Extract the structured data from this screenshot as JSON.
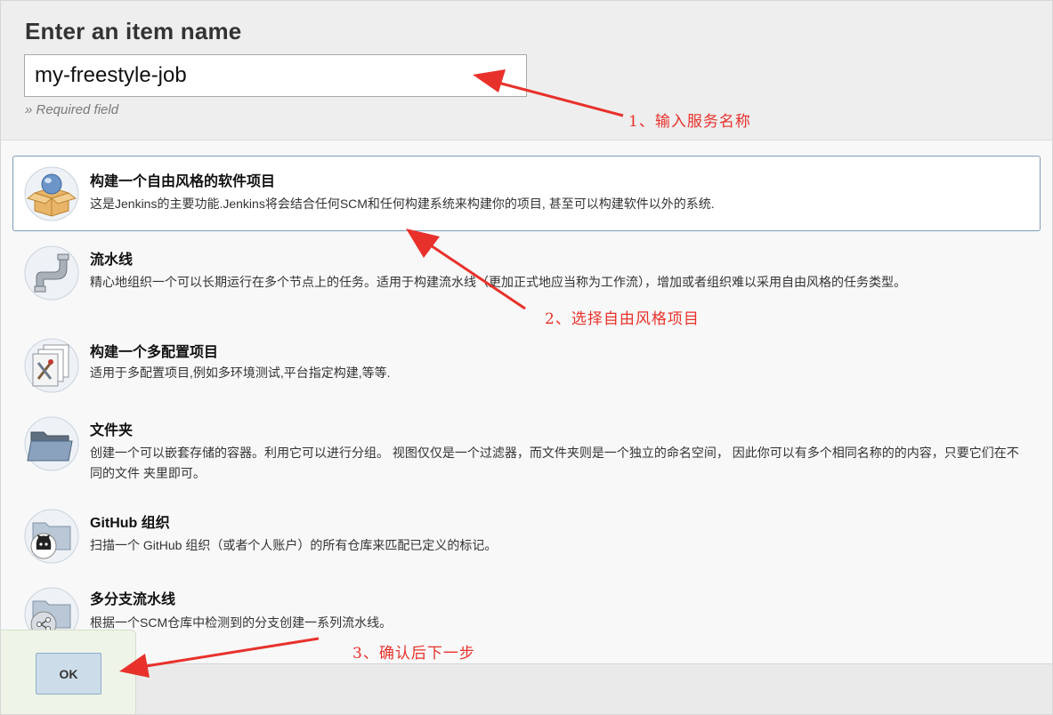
{
  "header": {
    "title": "Enter an item name",
    "item_name_value": "my-freestyle-job",
    "required_hint": "» Required field"
  },
  "items": [
    {
      "label": "构建一个自由风格的软件项目",
      "description": "这是Jenkins的主要功能.Jenkins将会结合任何SCM和任何构建系统来构建你的项目, 甚至可以构建软件以外的系统.",
      "icon": "freestyle-box-icon",
      "selected": true
    },
    {
      "label": "流水线",
      "description": "精心地组织一个可以长期运行在多个节点上的任务。适用于构建流水线（更加正式地应当称为工作流），增加或者组织难以采用自由风格的任务类型。",
      "icon": "pipeline-icon",
      "selected": false
    },
    {
      "label": "构建一个多配置项目",
      "description": "适用于多配置项目,例如多环境测试,平台指定构建,等等.",
      "icon": "multi-config-icon",
      "selected": false
    },
    {
      "label": "文件夹",
      "description": "创建一个可以嵌套存储的容器。利用它可以进行分组。 视图仅仅是一个过滤器，而文件夹则是一个独立的命名空间， 因此你可以有多个相同名称的的内容，只要它们在不同的文件 夹里即可。",
      "icon": "folder-icon",
      "selected": false
    },
    {
      "label": "GitHub 组织",
      "description": "扫描一个 GitHub 组织（或者个人账户）的所有仓库来匹配已定义的标记。",
      "icon": "github-organization-icon",
      "selected": false
    },
    {
      "label": "多分支流水线",
      "description": "根据一个SCM仓库中检测到的分支创建一系列流水线。",
      "icon": "multibranch-pipeline-icon",
      "selected": false
    }
  ],
  "footer": {
    "ok_label": "OK"
  },
  "annotations": {
    "step1": "1、输入服务名称",
    "step2": "2、选择自由风格项目",
    "step3": "3、确认后下一步",
    "color": "#e8312b"
  },
  "colors": {
    "selected_border": "#7e9cb7",
    "header_bg": "#eeeeee",
    "ok_button_bg": "#cddce9"
  }
}
